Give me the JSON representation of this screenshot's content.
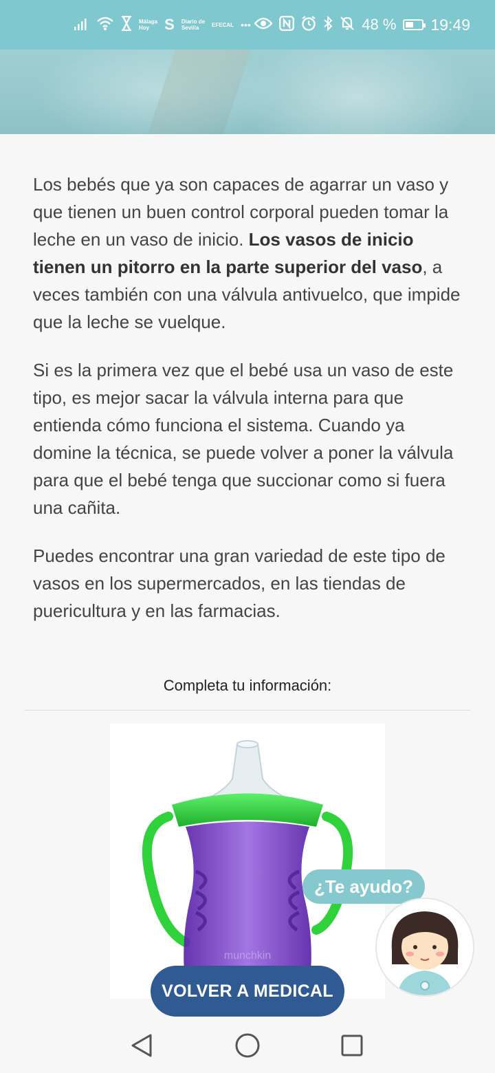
{
  "status_bar": {
    "icons": [
      "signal-icon",
      "wifi-icon",
      "hourglass-icon",
      "news-app-icon",
      "s-app-icon",
      "news-app-icon",
      "news-app-icon",
      "more-icon",
      "eye-icon",
      "nfc-icon",
      "alarm-icon",
      "bluetooth-icon",
      "mute-icon",
      "battery-icon"
    ],
    "mini_labels": [
      "Málaga\nHoy",
      "Diario de\nSevilla",
      "EFECAL"
    ],
    "more": "•••",
    "battery_pct": "48 %",
    "time": "19:49"
  },
  "article": {
    "p1_plain": "Los bebés que ya son capaces de agarrar un vaso y que tienen un buen control corporal pueden tomar la leche en un vaso de inicio. ",
    "p1_bold": "Los vasos de inicio tienen un pitorro en la parte superior del vaso",
    "p1_tail": ", a veces también con una válvula antivuelco, que impide que la leche se vuelque.",
    "p2": "Si es la primera vez que el bebé usa un vaso de este tipo, es mejor sacar la válvula interna para que entienda cómo funciona el sistema. Cuando ya domine la técnica, se puede volver a poner la válvula para que el bebé tenga que succionar como si fuera una cañita.",
    "p3": "Puedes encontrar una gran variedad de este tipo de vasos en los supermercados, en las tiendas de puericultura y en las farmacias."
  },
  "complete_info_title": "Completa tu información:",
  "product_image": {
    "icon": "sippy-cup-image",
    "brand_text": "munchkin"
  },
  "help_bubble": "¿Te ayudo?",
  "back_button": "VOLVER A MEDICAL",
  "nav": {
    "icons": [
      "back-triangle-icon",
      "home-circle-icon",
      "recents-square-icon"
    ]
  },
  "colors": {
    "status_bar": "#7fc8cf",
    "help_bubble": "#85c9cf",
    "back_button": "#2f5a92",
    "cup_green": "#2fd23a",
    "cup_purple": "#7a3cc8"
  }
}
